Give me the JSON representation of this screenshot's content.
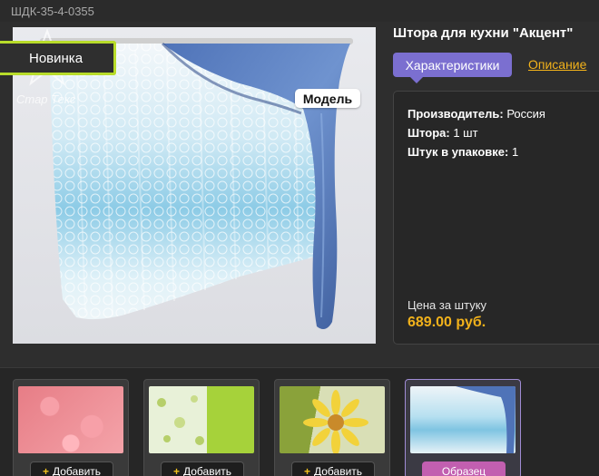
{
  "header": {
    "sku": "ШДК-35-4-0355"
  },
  "product": {
    "title": "Штора для кухни \"Акцент\"",
    "badge_new": "Новинка",
    "model_tag": "Модель",
    "watermark": "Стар Текс"
  },
  "tabs": {
    "characteristics": "Характеристики",
    "description": "Описание"
  },
  "specs": [
    {
      "label": "Производитель:",
      "value": "Россия"
    },
    {
      "label": "Штора:",
      "value": "1 шт"
    },
    {
      "label": "Штук в упаковке:",
      "value": "1"
    }
  ],
  "price": {
    "label": "Цена за штуку",
    "value": "689.00 руб."
  },
  "thumbnails": [
    {
      "button": "Добавить",
      "plus": "+"
    },
    {
      "button": "Добавить",
      "plus": "+"
    },
    {
      "button": "Добавить",
      "plus": "+"
    },
    {
      "button": "Образец"
    }
  ],
  "colors": {
    "accent_purple": "#7b6fd0",
    "price_orange": "#f2b21b",
    "badge_green": "#b8dc2a",
    "sample_pink": "#c25fb0"
  }
}
